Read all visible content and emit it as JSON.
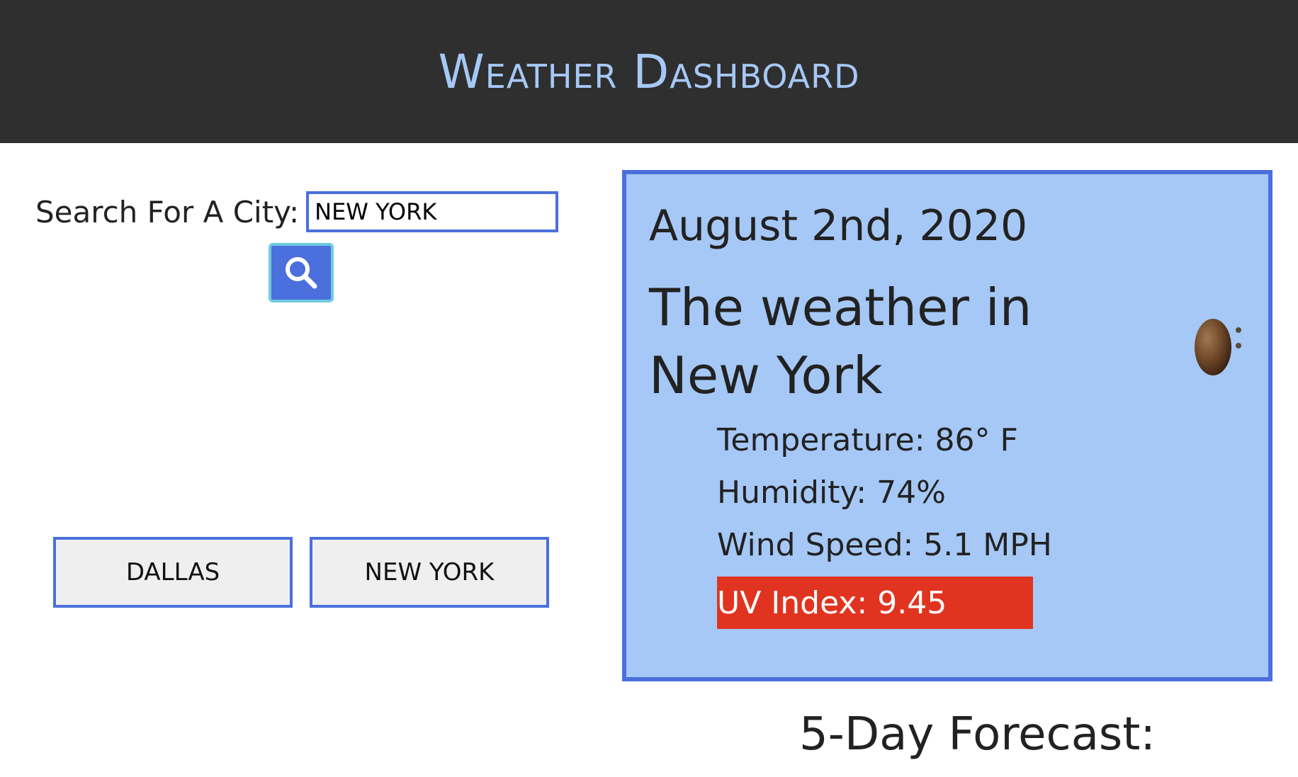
{
  "header": {
    "title": "Weather Dashboard"
  },
  "search": {
    "label": "Search For A City:",
    "value": "NEW YORK",
    "button_icon": "search-icon"
  },
  "history": {
    "items": [
      {
        "label": "DALLAS"
      },
      {
        "label": "NEW YORK"
      }
    ]
  },
  "current": {
    "date": "August 2nd, 2020",
    "heading": "The weather in New York",
    "icon": "weather-condition-icon",
    "temperature": "Temperature: 86° F",
    "humidity": "Humidity: 74%",
    "wind": "Wind Speed: 5.1 MPH",
    "uv": "UV Index: 9.45",
    "uv_color": "#e03420"
  },
  "forecast": {
    "title": "5-Day Forecast:"
  },
  "colors": {
    "header_bg": "#2f2f2f",
    "accent": "#4b6fdc",
    "card_bg": "#a6c8f6",
    "title_color": "#a6c8f6"
  }
}
